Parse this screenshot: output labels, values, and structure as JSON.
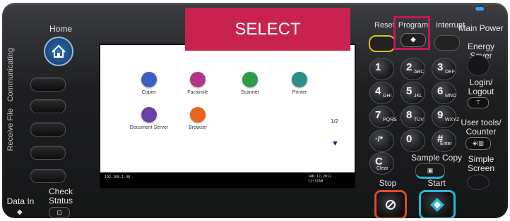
{
  "left": {
    "home_label": "Home",
    "communicating": "Communicating",
    "receive_file": "Receive File",
    "data_in": "Data In",
    "check_status": "Check Status"
  },
  "screen": {
    "apps": [
      {
        "label": "Copier",
        "icon": "copier-icon",
        "color": "#3d5fbf"
      },
      {
        "label": "Facsimile",
        "icon": "fax-icon",
        "color": "#b0358a"
      },
      {
        "label": "Scanner",
        "icon": "scanner-icon",
        "color": "#2e9b45"
      },
      {
        "label": "Printer",
        "icon": "printer-icon",
        "color": "#2e8e8c"
      },
      {
        "label": "Document Server",
        "icon": "document-server-icon",
        "color": "#6a3fa6"
      },
      {
        "label": "Browser",
        "icon": "browser-icon",
        "color": "#e8641c"
      }
    ],
    "page_indicator": "1/2",
    "ip_address": "192.168.1.40",
    "date": "JAN 17,2012",
    "time": "11:37AM"
  },
  "overlay": {
    "select_text": "SELECT",
    "highlight_color": "#c2185b"
  },
  "keys": {
    "reset": "Reset",
    "program": "Program",
    "interrupt": "Interrupt",
    "digits": [
      {
        "main": "1",
        "sub": ""
      },
      {
        "main": "2",
        "sub": "ABC"
      },
      {
        "main": "3",
        "sub": "DEF"
      },
      {
        "main": "4",
        "sub": "GHI"
      },
      {
        "main": "5",
        "sub": "JKL"
      },
      {
        "main": "6",
        "sub": "MNO"
      },
      {
        "main": "7",
        "sub": "PQRS"
      },
      {
        "main": "8",
        "sub": "TUV"
      },
      {
        "main": "9",
        "sub": "WXYZ"
      },
      {
        "main": "·/*",
        "sub": ""
      },
      {
        "main": "0",
        "sub": ""
      },
      {
        "main": "#",
        "sub": "Enter"
      }
    ],
    "clear_main": "C",
    "clear_sub": "Clear",
    "sample_copy": "Sample Copy",
    "stop": "Stop",
    "start": "Start"
  },
  "right": {
    "main_power": "Main Power",
    "energy_saver": "Energy Saver",
    "login_logout": "Login/ Logout",
    "user_tools": "User tools/ Counter",
    "simple_screen": "Simple Screen"
  },
  "colors": {
    "stop_ring": "#e04a2a",
    "start_ring": "#29b6d6",
    "main_power_led": "#2aa4ff"
  }
}
